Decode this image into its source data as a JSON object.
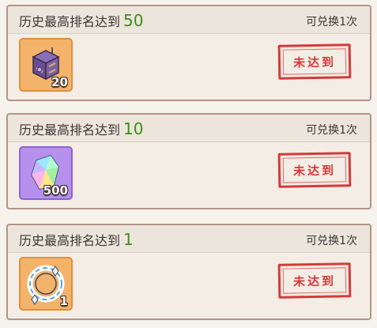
{
  "rewards": [
    {
      "title_prefix": "历史最高排名达到",
      "rank": "50",
      "limit": "可兑换1次",
      "item_icon": "treasure-chest-icon",
      "item_count": "20",
      "status": "未达到"
    },
    {
      "title_prefix": "历史最高排名达到",
      "rank": "10",
      "limit": "可兑换1次",
      "item_icon": "crystal-gem-icon",
      "item_count": "500",
      "status": "未达到"
    },
    {
      "title_prefix": "历史最高排名达到",
      "rank": "1",
      "limit": "可兑换1次",
      "item_icon": "crystal-ring-icon",
      "item_count": "1",
      "status": "未达到"
    }
  ],
  "colors": {
    "rank_green": "#3c8f1a",
    "stamp_red": "#d43a3a",
    "card_border": "#b39488",
    "orange_frame": "#f4b36a",
    "purple_frame": "#b590ec"
  }
}
